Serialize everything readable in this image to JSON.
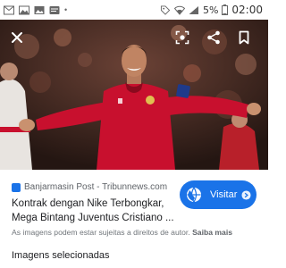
{
  "status_bar": {
    "icons": [
      "gmail-icon",
      "image-icon",
      "photo-icon",
      "message-icon",
      "more-dots-icon",
      "tag-icon",
      "wifi-icon",
      "signal-icon",
      "battery-icon"
    ],
    "battery_text": "5%",
    "time": "02:00"
  },
  "viewer": {
    "close_icon": "close-icon",
    "lens_icon": "lens-icon",
    "share_icon": "share-icon",
    "bookmark_icon": "bookmark-icon"
  },
  "result": {
    "source": "Banjarmasin Post - Tribunnews.com",
    "title_line1": "Kontrak dengan Nike Terbongkar,",
    "title_line2": "Mega Bintang Juventus Cristiano ...",
    "visit_label": "Visitar",
    "rights_text": "As imagens podem estar sujeitas a direitos de autor.",
    "learn_more": "Saiba mais",
    "selected_heading": "Imagens selecionadas"
  },
  "colors": {
    "accent": "#1a73e8",
    "jersey": "#c8102e"
  }
}
